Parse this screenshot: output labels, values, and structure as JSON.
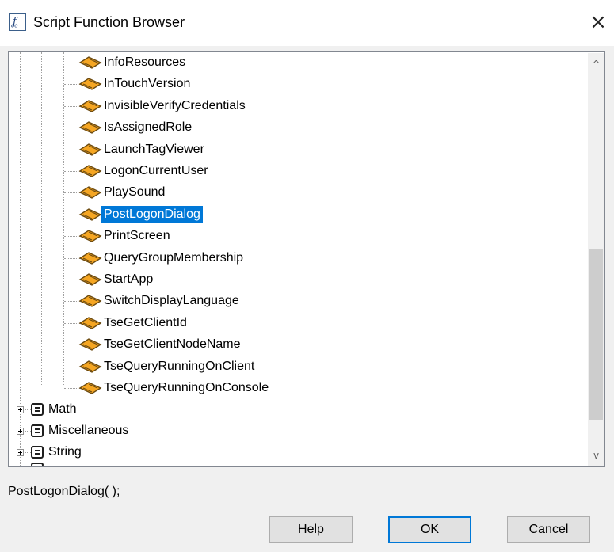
{
  "window": {
    "title": "Script Function Browser",
    "icon_text": "f",
    "icon_sub": "oo",
    "close_glyph": "×"
  },
  "tree": {
    "functions": [
      {
        "label": "InfoResources",
        "icon": "function-icon"
      },
      {
        "label": "InTouchVersion",
        "icon": "function-icon"
      },
      {
        "label": "InvisibleVerifyCredentials",
        "icon": "function-icon"
      },
      {
        "label": "IsAssignedRole",
        "icon": "function-icon"
      },
      {
        "label": "LaunchTagViewer",
        "icon": "function-icon"
      },
      {
        "label": "LogonCurrentUser",
        "icon": "function-icon"
      },
      {
        "label": "PlaySound",
        "icon": "function-icon"
      },
      {
        "label": "PostLogonDialog",
        "icon": "function-icon",
        "selected": true
      },
      {
        "label": "PrintScreen",
        "icon": "function-icon"
      },
      {
        "label": "QueryGroupMembership",
        "icon": "function-icon"
      },
      {
        "label": "StartApp",
        "icon": "function-icon"
      },
      {
        "label": "SwitchDisplayLanguage",
        "icon": "function-icon"
      },
      {
        "label": "TseGetClientId",
        "icon": "function-icon"
      },
      {
        "label": "TseGetClientNodeName",
        "icon": "function-icon"
      },
      {
        "label": "TseQueryRunningOnClient",
        "icon": "function-icon"
      },
      {
        "label": "TseQueryRunningOnConsole",
        "icon": "function-icon"
      }
    ],
    "groups": [
      {
        "label": "Math",
        "icon": "category-icon"
      },
      {
        "label": "Miscellaneous",
        "icon": "category-icon"
      },
      {
        "label": "String",
        "icon": "category-icon"
      }
    ],
    "selected_label": "PostLogonDialog"
  },
  "scrollbar": {
    "up_glyph": "^",
    "down_glyph": "v"
  },
  "expression": "PostLogonDialog( );",
  "buttons": {
    "help": "Help",
    "ok": "OK",
    "cancel": "Cancel"
  },
  "colors": {
    "selection": "#0078d7",
    "function_icon": "#f5a623",
    "default_button_border": "#0078d7"
  }
}
